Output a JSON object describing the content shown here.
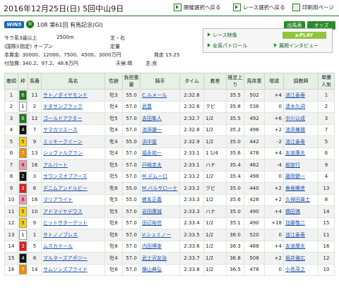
{
  "header": {
    "title": "2016年12月25日(日) 5回中山9日",
    "nav_select": "開催選択へ戻る",
    "race_select": "レース選択へ戻る",
    "print": "印刷用ページ"
  },
  "race": {
    "brand": "WIN5",
    "circle": "⑤",
    "title": "10R 第61回 有馬記念(GI)",
    "class": "サラ系3歳以上",
    "distance": "2500m",
    "course": "芝・右",
    "condition": "(国際)(指定) オープン",
    "weight_rule": "定量",
    "prize": "本賞金: 30000、12000、7500、4500、3000万円",
    "start": "発走 15:25",
    "extra_prize": "付加賞: 340.2、97.2、48.6万円",
    "weather": "天候:晴",
    "going": "芝:良",
    "btn_entries": "出馬表",
    "btn_odds": "オッズ"
  },
  "panel": {
    "video": "レース映像",
    "play": "PLAY",
    "patrol": "全周パトロール",
    "tarzan": "展開インタビュー"
  },
  "table": {
    "headers": [
      "着順",
      "枠",
      "馬番",
      "馬名",
      "性齢",
      "負担重量",
      "騎手",
      "タイム",
      "着差",
      "推定上り",
      "馬体重",
      "増減",
      "調教師",
      "単勝人気"
    ],
    "rows": [
      {
        "pos": "1",
        "waku": "6",
        "wc": "#1b7a1b",
        "wt": "#fff",
        "num": "11",
        "name": "サトノダイヤモンド",
        "sa": "牡3",
        "wgt": "55.0",
        "jockey": "C.ルメール",
        "time": "2:32.6",
        "margin": "",
        "up": "35.5",
        "bw": "502",
        "diff": "+4",
        "trainer": "池江泰寿",
        "pop": "1"
      },
      {
        "pos": "2",
        "waku": "1",
        "wc": "#ffffff",
        "wt": "#222",
        "num": "2",
        "name": "キタサンブラック",
        "sa": "牡4",
        "wgt": "57.0",
        "jockey": "武豊",
        "time": "2:32.6",
        "margin": "クビ",
        "up": "35.8",
        "bw": "536",
        "diff": "0",
        "trainer": "清水久詞",
        "pop": "2"
      },
      {
        "pos": "3",
        "waku": "6",
        "wc": "#1b7a1b",
        "wt": "#fff",
        "num": "12",
        "name": "ゴールドアクター",
        "sa": "牡5",
        "wgt": "57.0",
        "jockey": "吉田隼人",
        "time": "2:32.7",
        "margin": "1/2",
        "up": "35.5",
        "bw": "492",
        "diff": "+6",
        "trainer": "中川公成",
        "pop": "3"
      },
      {
        "pos": "4",
        "waku": "4",
        "wc": "#111111",
        "wt": "#fff",
        "num": "7",
        "name": "ヤマカツエース",
        "sa": "牡4",
        "wgt": "57.0",
        "jockey": "池添謙一",
        "time": "2:32.8",
        "margin": "1/2",
        "up": "35.2",
        "bw": "496",
        "diff": "+2",
        "trainer": "池添兼雄",
        "pop": "7"
      },
      {
        "pos": "5",
        "waku": "5",
        "wc": "#ffd200",
        "wt": "#222",
        "num": "9",
        "name": "ミッキークイーン",
        "sa": "牝4",
        "wgt": "55.0",
        "jockey": "浜中俊",
        "time": "2:32.9",
        "margin": "1/2",
        "up": "35.0",
        "bw": "442",
        "diff": "-2",
        "trainer": "池江泰寿",
        "pop": "5"
      },
      {
        "pos": "6",
        "waku": "7",
        "wc": "#f08c00",
        "wt": "#fff",
        "num": "13",
        "name": "シュヴァルグラン",
        "sa": "牡4",
        "wgt": "57.0",
        "jockey": "福永祐一",
        "time": "2:33.1",
        "margin": "1 1/4",
        "up": "35.6",
        "bw": "476",
        "diff": "+4",
        "trainer": "友道康夫",
        "pop": "6"
      },
      {
        "pos": "7",
        "waku": "8",
        "wc": "#f39ab3",
        "wt": "#222",
        "num": "16",
        "name": "アルバート",
        "sa": "牡5",
        "wgt": "57.0",
        "jockey": "戸崎圭太",
        "time": "2:33.1",
        "margin": "ハナ",
        "up": "35.4",
        "bw": "462",
        "diff": "-4",
        "trainer": "堀宣行",
        "pop": "9"
      },
      {
        "pos": "8",
        "waku": "2",
        "wc": "#111111",
        "wt": "#fff",
        "num": "3",
        "name": "サウンズオブアース",
        "sa": "牡5",
        "wgt": "57.0",
        "jockey": "M.デムーロ",
        "time": "2:33.2",
        "margin": "1/2",
        "up": "35.4",
        "bw": "498",
        "diff": "0",
        "trainer": "藤岡健一",
        "pop": "4"
      },
      {
        "pos": "9",
        "waku": "3",
        "wc": "#d81f1f",
        "wt": "#fff",
        "num": "6",
        "name": "デニムアンドルビー",
        "sa": "牝6",
        "wgt": "55.0",
        "jockey": "M.バルザローナ",
        "time": "2:33.2",
        "margin": "クビ",
        "up": "35.0",
        "bw": "440",
        "diff": "+2",
        "trainer": "角居勝彦",
        "pop": "13"
      },
      {
        "pos": "10",
        "waku": "8",
        "wc": "#f39ab3",
        "wt": "#222",
        "num": "16",
        "name": "マリアライト",
        "sa": "牝5",
        "wgt": "55.0",
        "jockey": "蛯名正義",
        "time": "2:33.3",
        "margin": "1/2",
        "up": "35.6",
        "bw": "426",
        "diff": "+2",
        "trainer": "久保田貴士",
        "pop": "8"
      },
      {
        "pos": "11",
        "waku": "5",
        "wc": "#ffd200",
        "wt": "#222",
        "num": "10",
        "name": "アドマイヤデウス",
        "sa": "牡5",
        "wgt": "57.0",
        "jockey": "岩田康誠",
        "time": "2:33.3",
        "margin": "ハナ",
        "up": "35.0",
        "bw": "490",
        "diff": "+4",
        "trainer": "橋田満",
        "pop": "14"
      },
      {
        "pos": "12",
        "waku": "5",
        "wc": "#ffd200",
        "wt": "#222",
        "num": "9",
        "name": "ヒットザターゲット",
        "sa": "牡8",
        "wgt": "57.0",
        "jockey": "田辺裕信",
        "time": "2:33.4",
        "margin": "1/2",
        "up": "35.1",
        "bw": "490",
        "diff": "+18",
        "trainer": "加藤敬二",
        "pop": "15"
      },
      {
        "pos": "13",
        "waku": "1",
        "wc": "#ffffff",
        "wt": "#222",
        "num": "1",
        "name": "サトノノブレス",
        "sa": "牡6",
        "wgt": "57.0",
        "jockey": "V.シュミノー",
        "time": "2:33.5",
        "margin": "1/2",
        "up": "36.0",
        "bw": "520",
        "diff": "0",
        "trainer": "池江泰寿",
        "pop": "11"
      },
      {
        "pos": "14",
        "waku": "3",
        "wc": "#d81f1f",
        "wt": "#fff",
        "num": "5",
        "name": "ムスカテール",
        "sa": "牡8",
        "wgt": "57.0",
        "jockey": "内田博幸",
        "time": "2:33.6",
        "margin": "1/2",
        "up": "36.3",
        "bw": "488",
        "diff": "+4",
        "trainer": "友道康夫",
        "pop": "16"
      },
      {
        "pos": "15",
        "waku": "4",
        "wc": "#111111",
        "wt": "#fff",
        "num": "8",
        "name": "マルターズアポジー",
        "sa": "牡4",
        "wgt": "57.0",
        "jockey": "武士沢友治",
        "time": "2:33.7",
        "margin": "1/2",
        "up": "36.8",
        "bw": "508",
        "diff": "+2",
        "trainer": "堀井雅広",
        "pop": "12"
      },
      {
        "pos": "16",
        "waku": "7",
        "wc": "#f08c00",
        "wt": "#fff",
        "num": "14",
        "name": "サムソンズプライド",
        "sa": "牡6",
        "wgt": "57.0",
        "jockey": "横山典弘",
        "time": "2:33.8",
        "margin": "1/2",
        "up": "36.5",
        "bw": "478",
        "diff": "0",
        "trainer": "小島茂之",
        "pop": "10"
      }
    ]
  }
}
